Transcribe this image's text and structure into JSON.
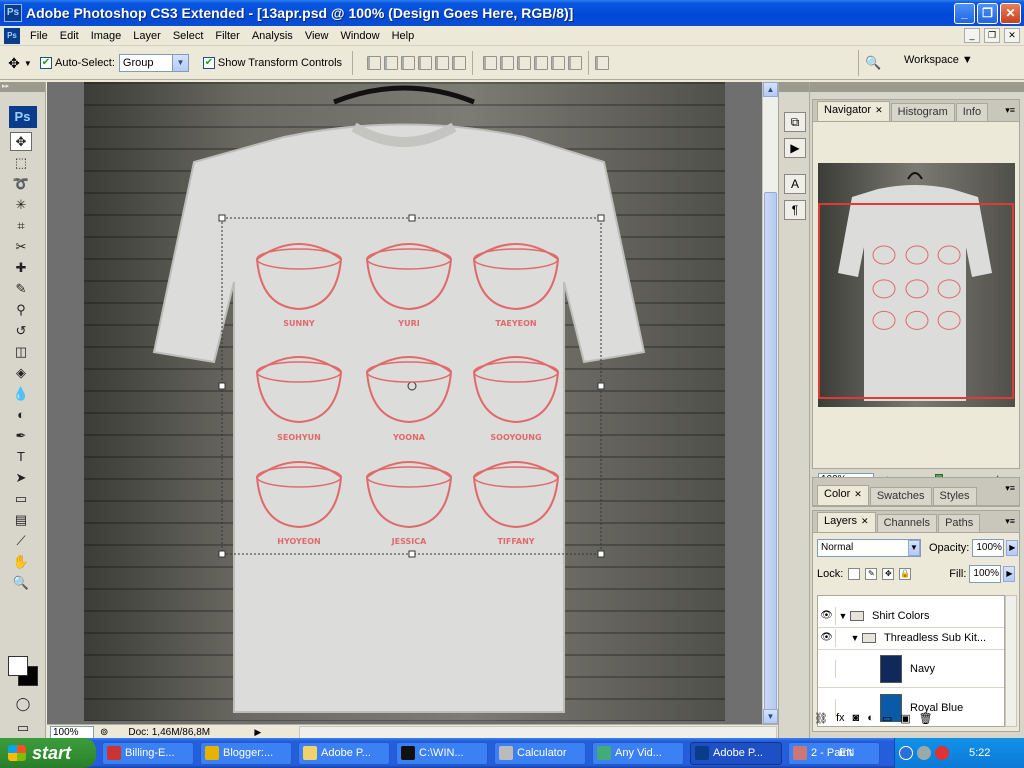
{
  "window": {
    "title": "Adobe Photoshop CS3 Extended - [13apr.psd @ 100% (Design Goes Here, RGB/8)]"
  },
  "menu": [
    "File",
    "Edit",
    "Image",
    "Layer",
    "Select",
    "Filter",
    "Analysis",
    "View",
    "Window",
    "Help"
  ],
  "options": {
    "auto_select_label": "Auto-Select:",
    "auto_select_checked": true,
    "auto_select_value": "Group",
    "show_transform_label": "Show Transform Controls",
    "show_transform_checked": true,
    "workspace_label": "Workspace"
  },
  "toolbox": {
    "logo": "Ps"
  },
  "status": {
    "zoom": "100%",
    "doc_info": "Doc: 1,46M/86,8M"
  },
  "navigator": {
    "tabs": [
      "Navigator",
      "Histogram",
      "Info"
    ],
    "zoom": "100%"
  },
  "color_panel": {
    "tabs": [
      "Color",
      "Swatches",
      "Styles"
    ]
  },
  "layers_panel": {
    "tabs": [
      "Layers",
      "Channels",
      "Paths"
    ],
    "blend_mode": "Normal",
    "opacity_label": "Opacity:",
    "opacity": "100%",
    "lock_label": "Lock:",
    "fill_label": "Fill:",
    "fill": "100%",
    "layers": [
      {
        "name": "Shirt Colors",
        "type": "group",
        "visible": true
      },
      {
        "name": "Threadless Sub Kit...",
        "type": "group",
        "visible": true
      },
      {
        "name": "Navy",
        "type": "layer",
        "visible": false,
        "swatch": "#0f2a5a"
      },
      {
        "name": "Royal Blue",
        "type": "layer",
        "visible": false,
        "swatch": "#0b5aa8"
      }
    ]
  },
  "design": {
    "names": [
      "SUNNY",
      "YURI",
      "TAEYEON",
      "SEOHYUN",
      "YOONA",
      "SOOYOUNG",
      "HYOYEON",
      "JESSICA",
      "TIFFANY"
    ],
    "ink_color": "#e06a6a"
  },
  "taskbar": {
    "start": "start",
    "tasks": [
      {
        "label": "Billing-E...",
        "icon": "flag-icon"
      },
      {
        "label": "Blogger:...",
        "icon": "chrome-icon"
      },
      {
        "label": "Adobe P...",
        "icon": "folder-icon"
      },
      {
        "label": "C:\\WIN...",
        "icon": "cmd-icon"
      },
      {
        "label": "Calculator",
        "icon": "calculator-icon"
      },
      {
        "label": "Any Vid...",
        "icon": "video-icon"
      },
      {
        "label": "Adobe P...",
        "icon": "photoshop-icon",
        "active": true
      },
      {
        "label": "2 - Paint",
        "icon": "paint-icon"
      }
    ],
    "lang": "EN",
    "clock": "5:22"
  }
}
